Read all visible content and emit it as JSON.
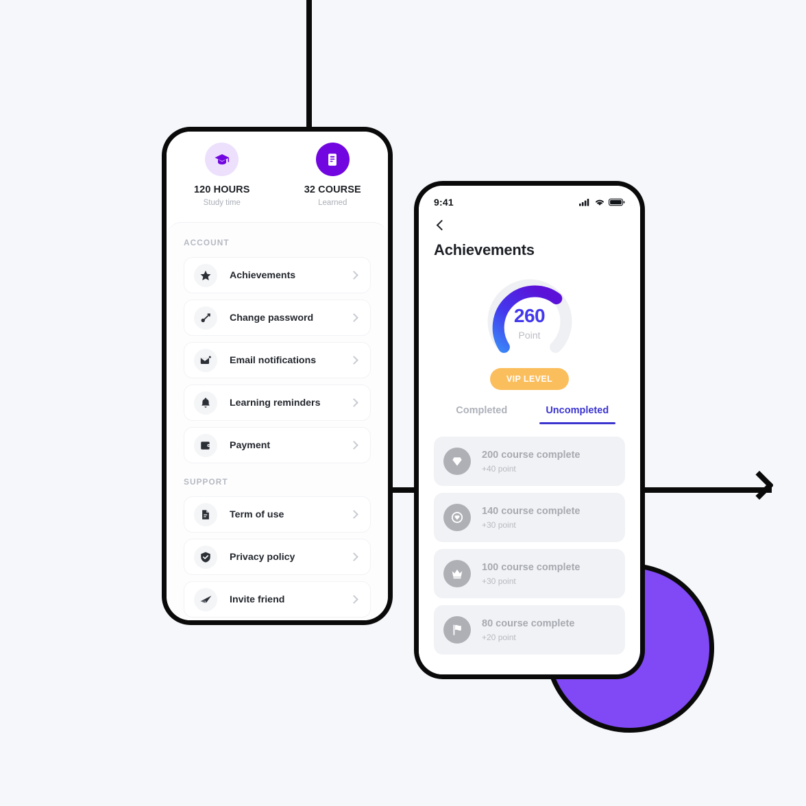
{
  "background_color": "#f5f7fa",
  "accent_purple": "#7106e0",
  "accent_blue": "#3b35cf",
  "accent_amber": "#fbbe5d",
  "blob_color": "#8049f5",
  "phone_settings": {
    "stats": [
      {
        "icon": "graduation-cap-icon",
        "value": "120 HOURS",
        "label": "Study time",
        "style": "lavender"
      },
      {
        "icon": "document-icon",
        "value": "32 COURSE",
        "label": "Learned",
        "style": "purple"
      }
    ],
    "sections": [
      {
        "heading": "ACCOUNT",
        "items": [
          {
            "icon": "star-icon",
            "label": "Achievements"
          },
          {
            "icon": "key-icon",
            "label": "Change password"
          },
          {
            "icon": "envelope-icon",
            "label": "Email notifications"
          },
          {
            "icon": "bell-icon",
            "label": "Learning reminders"
          },
          {
            "icon": "wallet-icon",
            "label": "Payment"
          }
        ]
      },
      {
        "heading": "SUPPORT",
        "items": [
          {
            "icon": "document-text-icon",
            "label": "Term of use"
          },
          {
            "icon": "shield-check-icon",
            "label": "Privacy policy"
          },
          {
            "icon": "paper-plane-icon",
            "label": "Invite friend"
          }
        ]
      }
    ]
  },
  "phone_achievements": {
    "statusbar": {
      "time": "9:41",
      "signal": "cellular-signal-icon",
      "wifi": "wifi-icon",
      "battery": "battery-icon"
    },
    "back": "back-chevron-icon",
    "title": "Achievements",
    "gauge": {
      "value": "260",
      "unit": "Point",
      "percent": 62,
      "track_color": "#eff0f3",
      "gradient_start": "#3b82f6",
      "gradient_end": "#5b11d8"
    },
    "vip_label": "VIP LEVEL",
    "tabs": [
      {
        "label": "Completed",
        "active": false
      },
      {
        "label": "Uncompleted",
        "active": true
      }
    ],
    "items": [
      {
        "icon": "diamond-icon",
        "name": "200 course complete",
        "points": "+40 point"
      },
      {
        "icon": "gem-circle-icon",
        "name": "140 course complete",
        "points": "+30 point"
      },
      {
        "icon": "crown-icon",
        "name": "100 course complete",
        "points": "+30 point"
      },
      {
        "icon": "flag-icon",
        "name": "80 course complete",
        "points": "+20 point"
      }
    ]
  }
}
